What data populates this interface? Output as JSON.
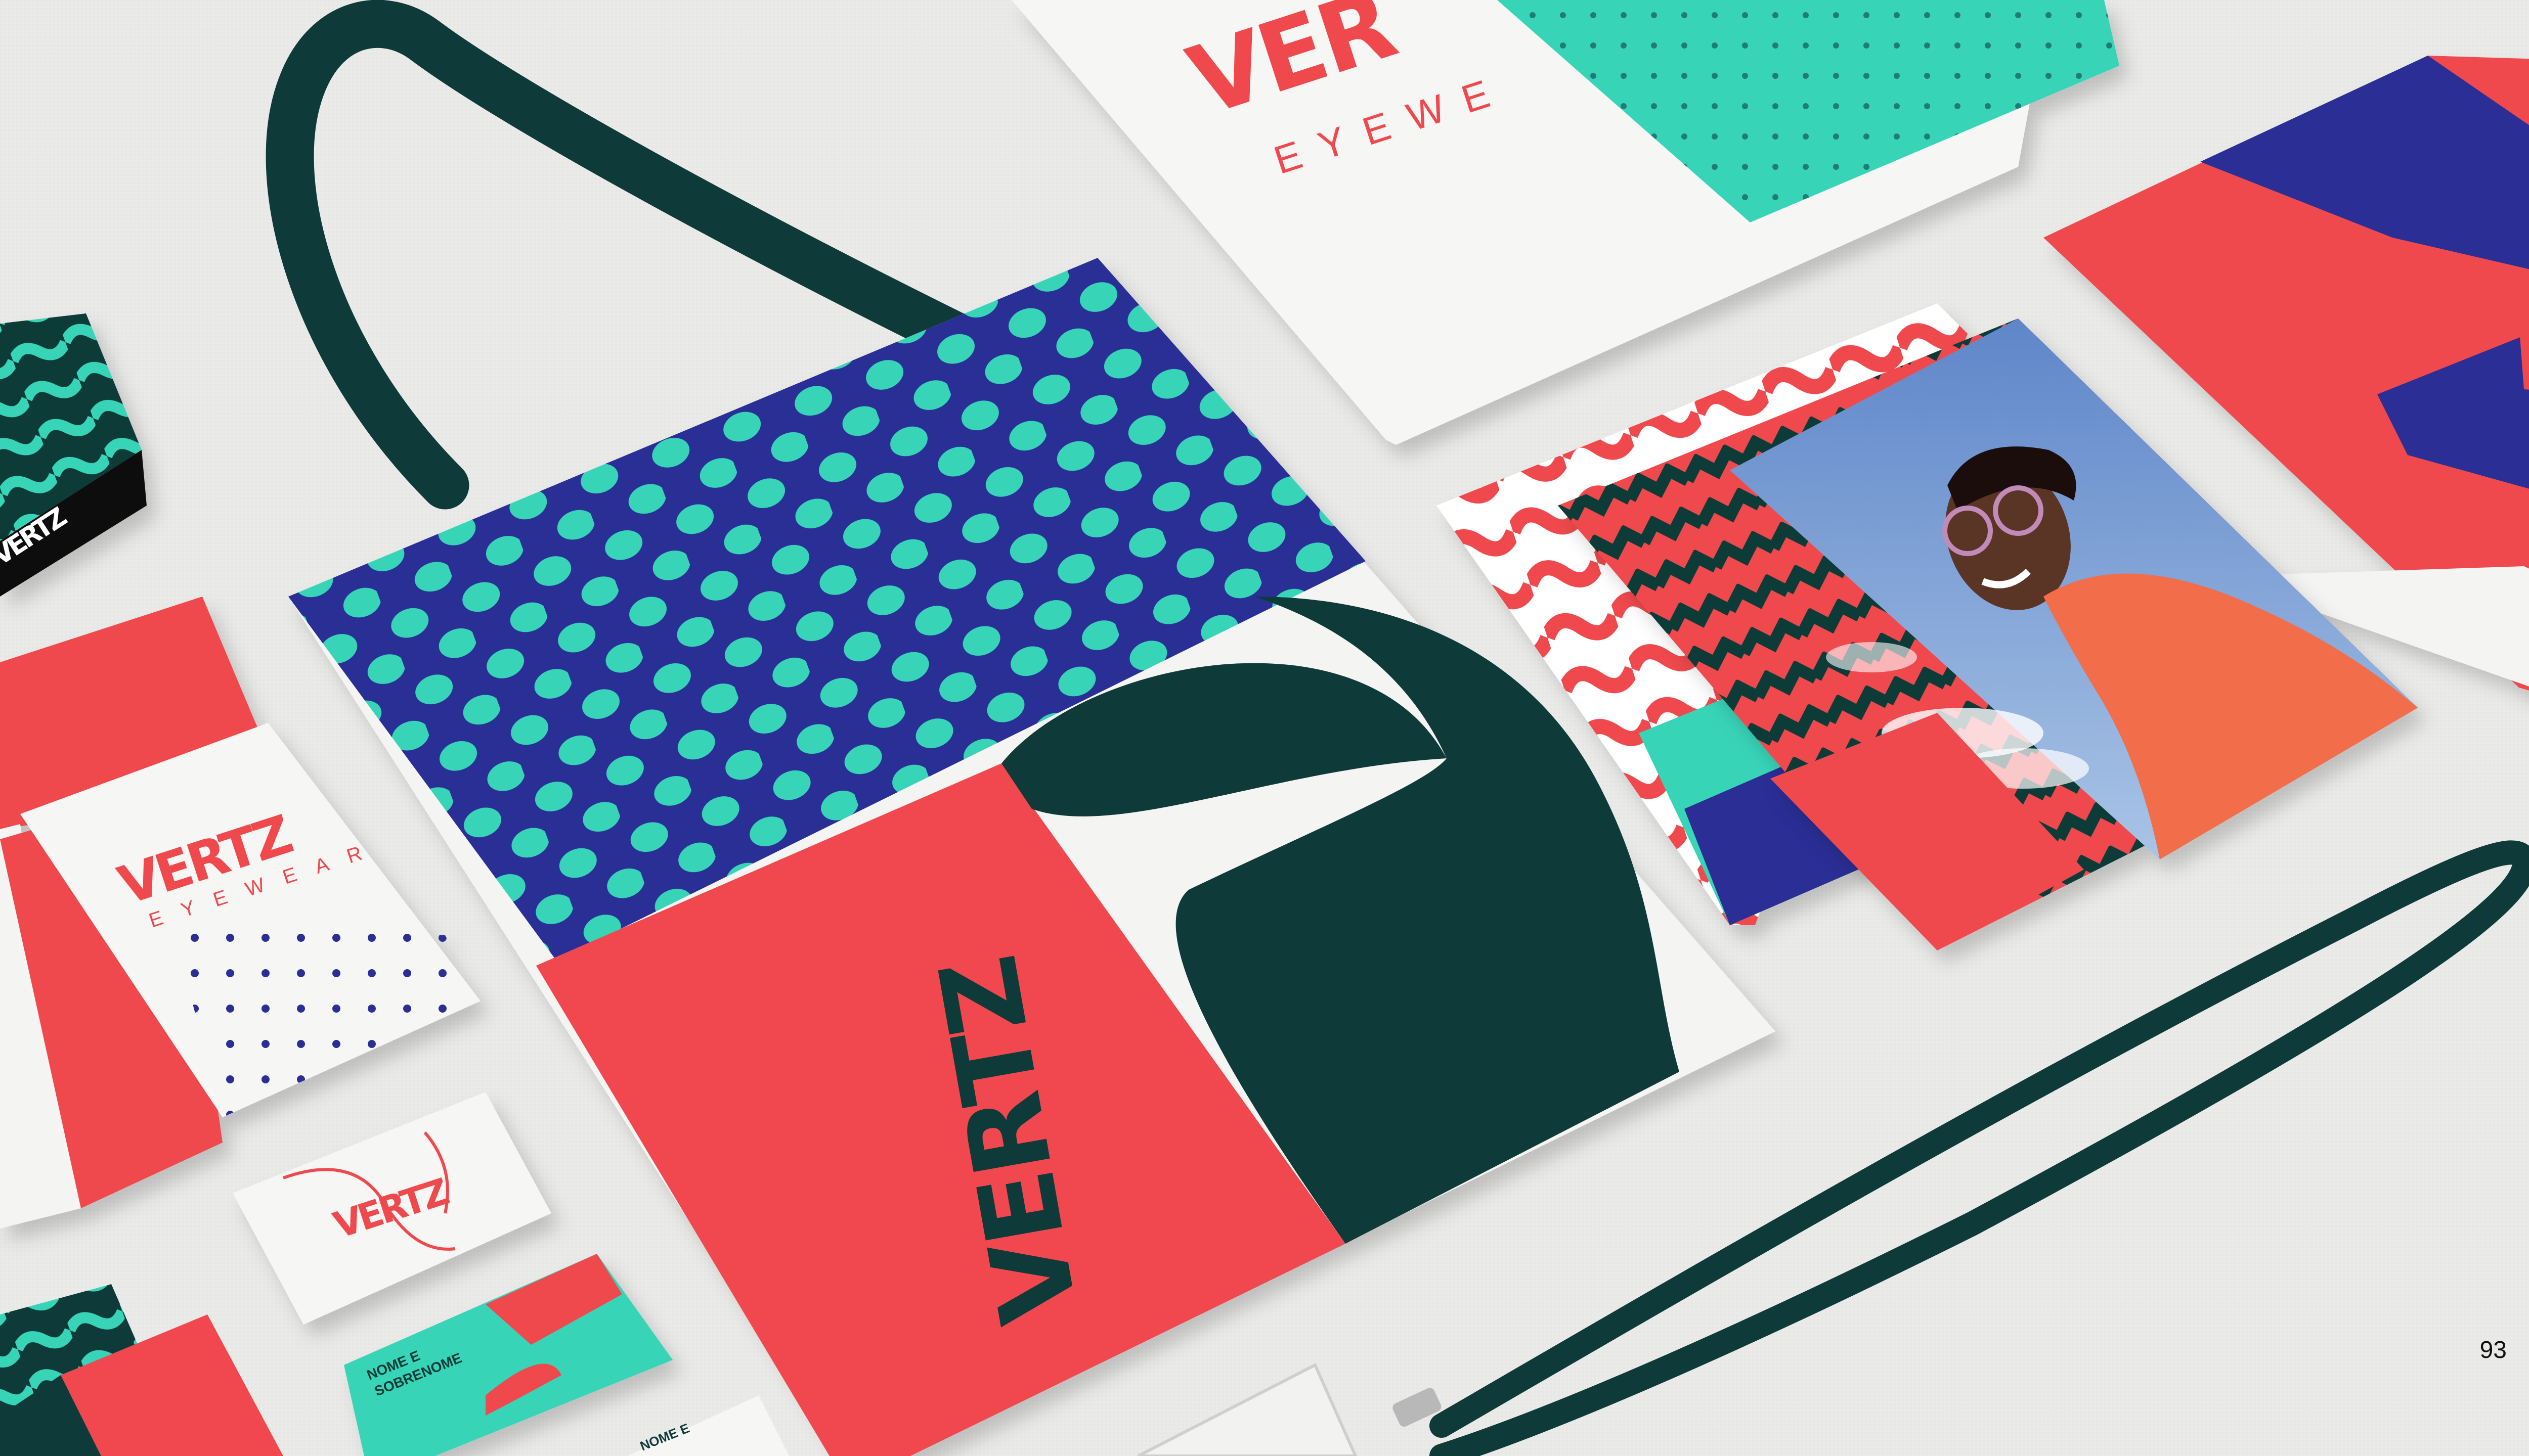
{
  "scene": {
    "brand_name": "VERTZ",
    "brand_sub": "EYEWEAR",
    "brand_sub_partial": "EYEWE",
    "brand_name_partial": "VER",
    "card_name_line1": "NOME E",
    "card_name_line2": "SOBRENOME",
    "page_number": "93"
  },
  "colors": {
    "coral": "#f0484e",
    "teal": "#38d4b8",
    "navy": "#2a2f95",
    "dark_green": "#0e3a39",
    "paper": "#f4f4f2",
    "background": "#e8e8e7"
  }
}
